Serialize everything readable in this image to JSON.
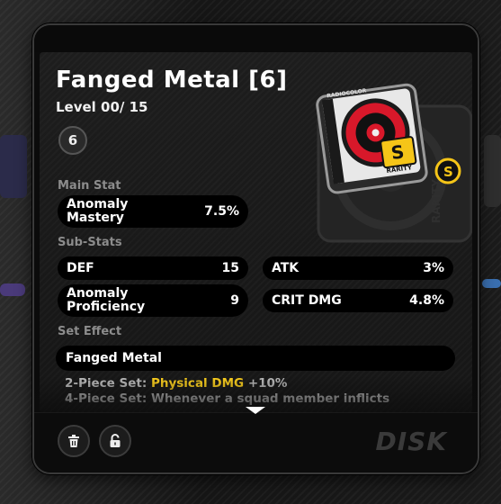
{
  "disk": {
    "name": "Fanged Metal [6]",
    "level": "Level 00/ 15",
    "slot": "6",
    "rarity_badge": "S",
    "rarity_text": "RARITY",
    "art_brand": "RADIOCOLOR"
  },
  "main_stat": {
    "section_label": "Main Stat",
    "name": "Anomaly Mastery",
    "value": "7.5%"
  },
  "sub_stats": {
    "section_label": "Sub-Stats",
    "items": [
      {
        "name": "DEF",
        "value": "15"
      },
      {
        "name": "ATK",
        "value": "3%"
      },
      {
        "name": "Anomaly Proficiency",
        "value": "9"
      },
      {
        "name": "CRIT DMG",
        "value": "4.8%"
      }
    ]
  },
  "set_effect": {
    "section_label": "Set Effect",
    "set_name": "Fanged Metal",
    "two_piece_prefix": "2-Piece Set:",
    "two_piece_highlight": "Physical DMG",
    "two_piece_suffix": "+10%",
    "four_piece": "4-Piece Set: Whenever a squad member inflicts"
  },
  "footer": {
    "category": "DISK"
  },
  "colors": {
    "highlight": "#ffd21e",
    "disk_red": "#d8182a",
    "badge_yellow": "#f5c518"
  }
}
